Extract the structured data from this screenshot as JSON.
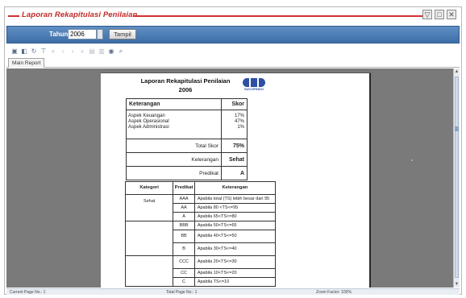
{
  "window": {
    "title": "Laporan Rekapitulasi Penilaian",
    "buttons": [
      "▽",
      "□",
      "✕"
    ]
  },
  "filter": {
    "year_label": "Tahun",
    "year_value": "2006",
    "show_button": "Tampil"
  },
  "toolbar": {
    "icons": [
      "print-icon",
      "export-icon",
      "refresh-icon",
      "tree-icon",
      "first-page-icon",
      "prev-page-icon",
      "next-page-icon",
      "last-page-icon",
      "page-setup-icon",
      "page-layout-icon",
      "zoom-icon",
      "search-icon"
    ]
  },
  "tabs": [
    {
      "label": "Main Report"
    }
  ],
  "report": {
    "title_line1": "Laporan Rekapitulasi Penilaian",
    "title_line2": "2006",
    "logo_text": "SUCOFINDO",
    "summary": {
      "header_keterangan": "Keterangan",
      "header_skor": "Skor",
      "aspects": [
        {
          "label": "Aspek Keuangan",
          "value": "17%"
        },
        {
          "label": "Aspek Operasional",
          "value": "47%"
        },
        {
          "label": "Aspek Administrasi",
          "value": "1%"
        }
      ],
      "total_label": "Total Skor",
      "total_value": "75%",
      "keterangan_label": "Keterangan",
      "keterangan_value": "Sehat",
      "predikat_label": "Predikat",
      "predikat_value": "A"
    },
    "criteria": {
      "headers": [
        "Kategori",
        "Predikat",
        "Keterangan"
      ],
      "groups": [
        {
          "kategori": "Sehat",
          "rows": [
            {
              "predikat": "AAA",
              "keterangan": "Apabila total (TS) lebih besar dari 95"
            },
            {
              "predikat": "AA",
              "keterangan": "Apabila 80 <TS<=95"
            },
            {
              "predikat": "A",
              "keterangan": "Apabila 65<TS<=80"
            }
          ]
        },
        {
          "kategori": "",
          "rows": [
            {
              "predikat": "BBB",
              "keterangan": "Apabila 50<TS<=65"
            },
            {
              "predikat": "BB",
              "keterangan": "Apabila 40<TS<=50"
            },
            {
              "predikat": "B",
              "keterangan": "Apabila 30<TS<=40"
            }
          ]
        },
        {
          "kategori": "",
          "rows": [
            {
              "predikat": "CCC",
              "keterangan": "Apabila 20<TS<=30"
            },
            {
              "predikat": "CC",
              "keterangan": "Apabila 10<TS<=20"
            },
            {
              "predikat": "C",
              "keterangan": "Apabila TS<=10"
            }
          ]
        }
      ]
    }
  },
  "status": {
    "current_page": "Current Page No.: 1",
    "total_page": "Total Page No.: 1",
    "zoom": "Zoom Factor: 100%"
  }
}
